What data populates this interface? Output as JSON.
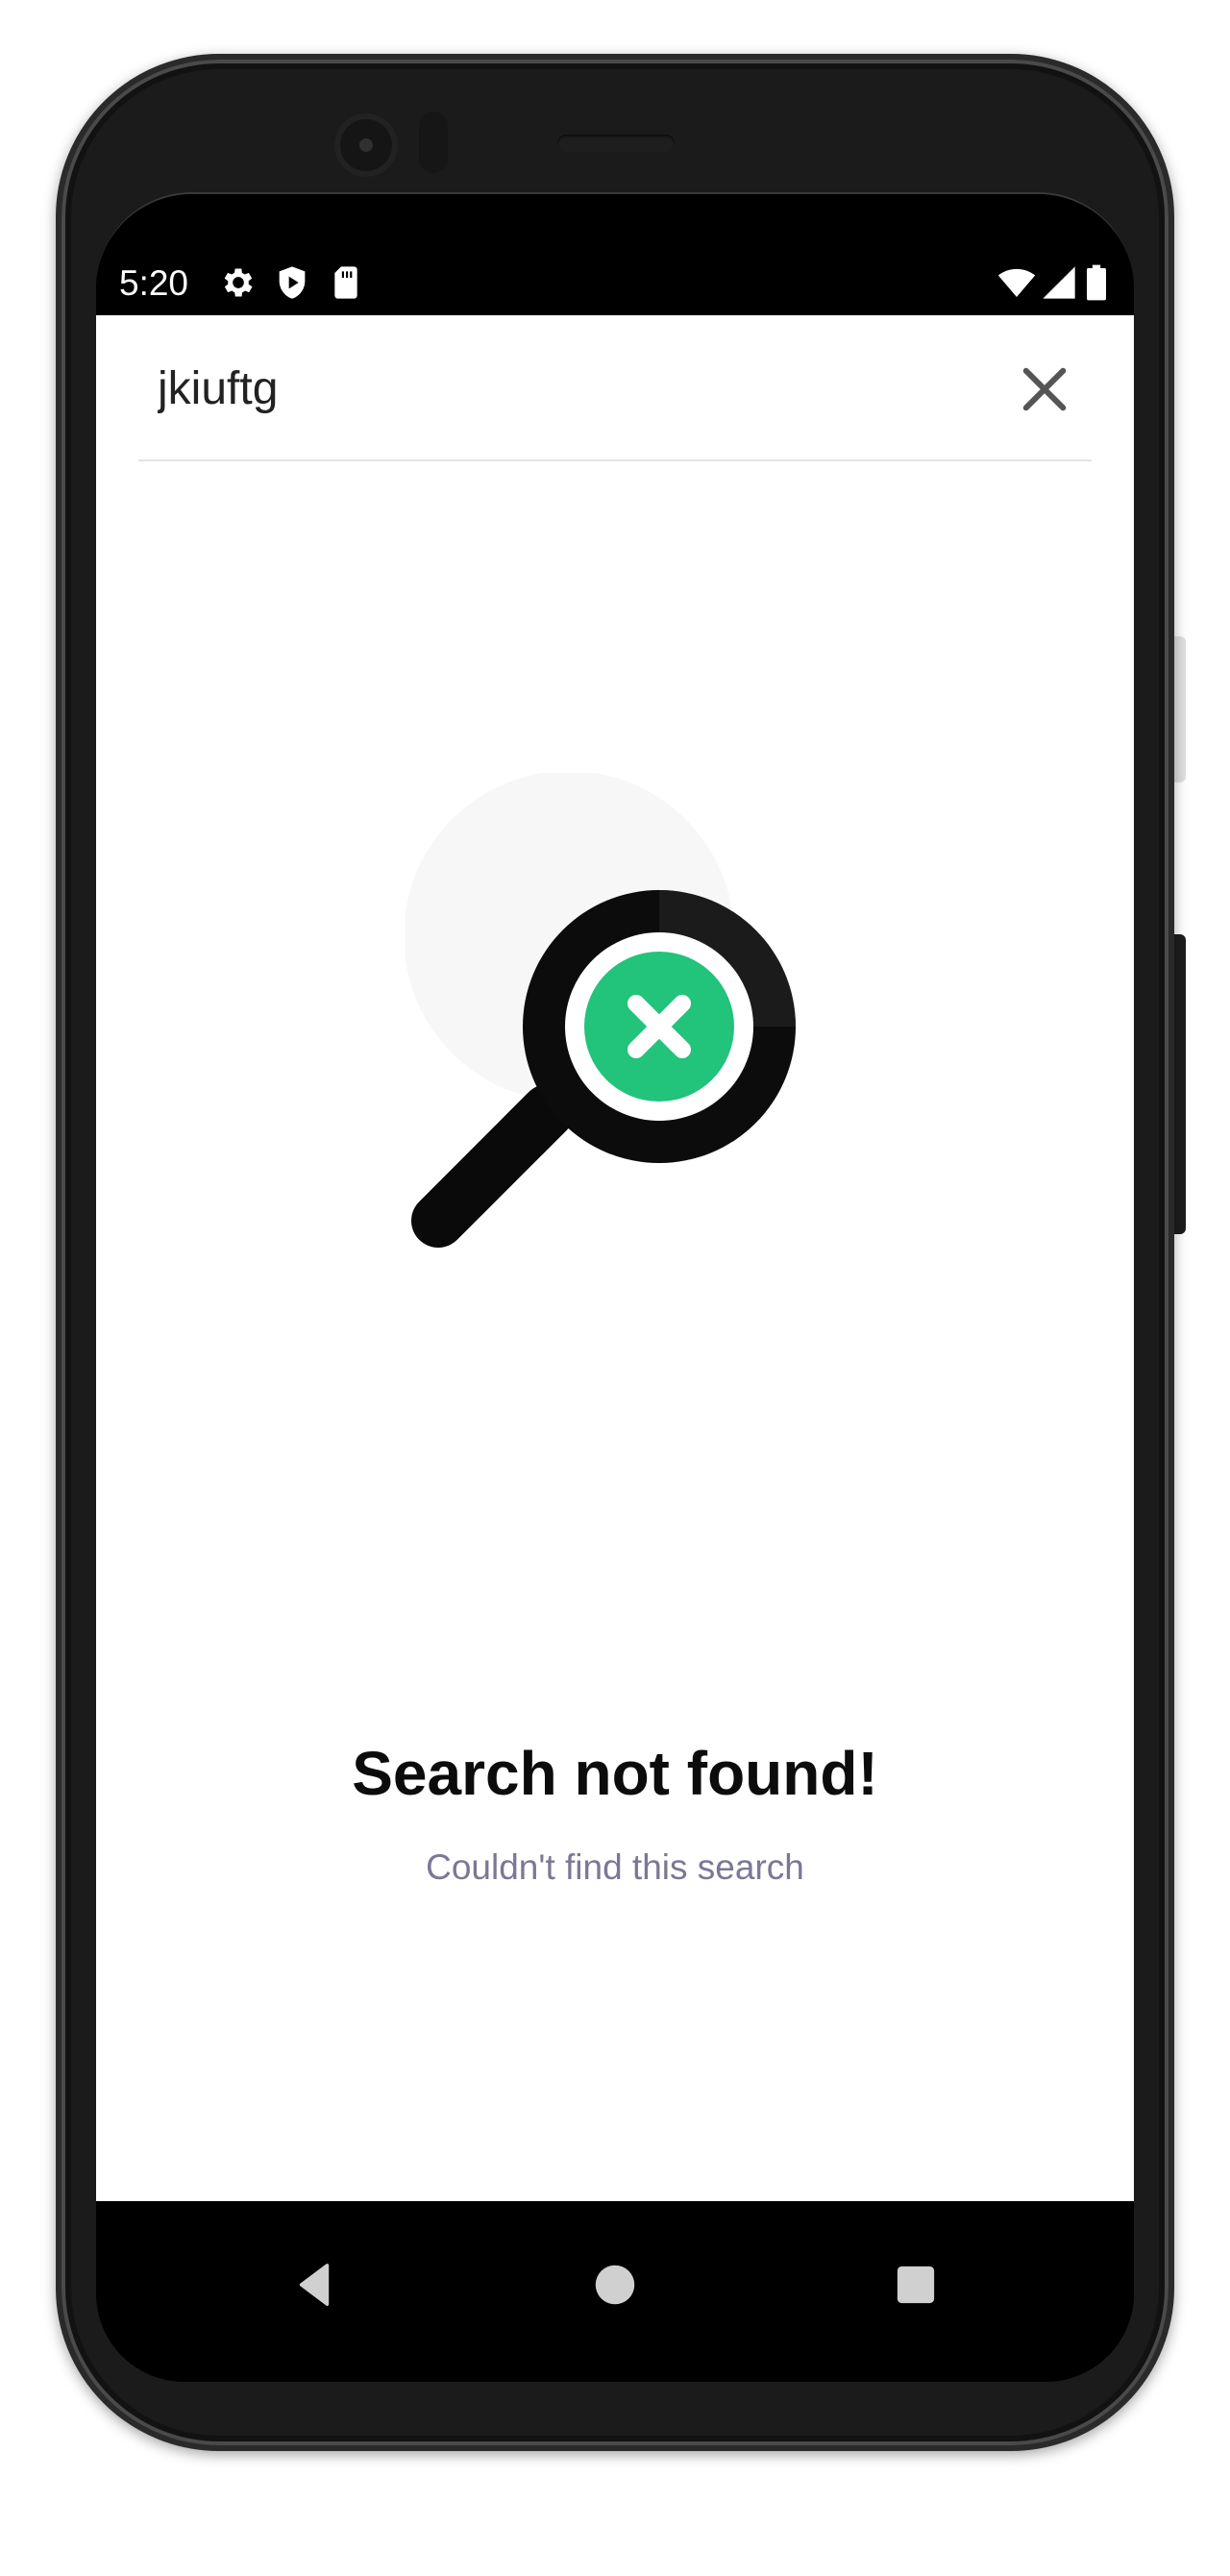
{
  "status_bar": {
    "time": "5:20",
    "left_icons": [
      "gear-icon",
      "shield-play-icon",
      "sd-card-icon"
    ],
    "right_icons": [
      "wifi-icon",
      "cell-signal-icon",
      "battery-icon"
    ]
  },
  "search": {
    "value": "jkiuftg",
    "clear_icon": "close-icon"
  },
  "empty_state": {
    "illustration": "magnifier-not-found-icon",
    "title": "Search not found!",
    "subtitle": "Couldn't find this search"
  },
  "nav_bar": {
    "buttons": [
      "back-triangle-icon",
      "home-circle-icon",
      "recents-square-icon"
    ]
  },
  "colors": {
    "accent_green": "#22c37a",
    "subtitle_text": "#7a7894",
    "frame": "#1b1b1b"
  }
}
